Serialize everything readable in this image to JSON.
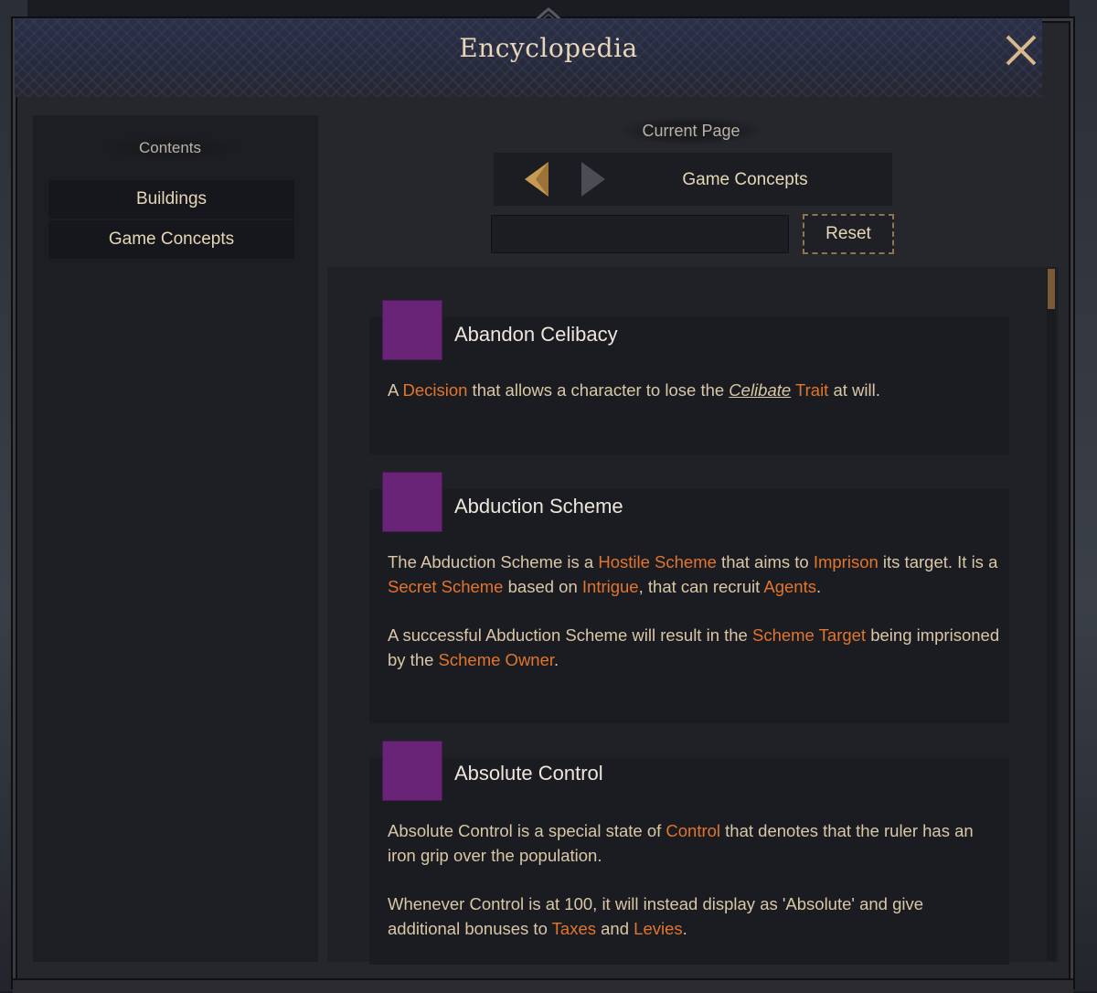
{
  "window": {
    "title": "Encyclopedia",
    "close_icon": "close-icon"
  },
  "sidebar": {
    "header": "Contents",
    "items": [
      {
        "label": "Buildings"
      },
      {
        "label": "Game Concepts"
      }
    ]
  },
  "navigation": {
    "current_page_label": "Current Page",
    "page": "Game Concepts",
    "back_icon": "arrow-left-icon",
    "forward_icon": "arrow-right-icon",
    "search": {
      "value": "",
      "placeholder": ""
    },
    "reset_label": "Reset"
  },
  "entries": [
    {
      "title": "Abandon Celibacy",
      "icon_color": "#6a2477",
      "paragraphs": [
        [
          {
            "text": "A "
          },
          {
            "text": "Decision",
            "link": true
          },
          {
            "text": " that allows a character to lose the "
          },
          {
            "text": "Celibate",
            "link": "italic"
          },
          {
            "text": " "
          },
          {
            "text": "Trait",
            "link": true
          },
          {
            "text": " at will."
          }
        ]
      ]
    },
    {
      "title": "Abduction Scheme",
      "icon_color": "#6a2477",
      "paragraphs": [
        [
          {
            "text": "The Abduction Scheme is a "
          },
          {
            "text": "Hostile Scheme",
            "link": true
          },
          {
            "text": " that aims to "
          },
          {
            "text": "Imprison",
            "link": true
          },
          {
            "text": " its target. It is a "
          },
          {
            "text": "Secret Scheme",
            "link": true
          },
          {
            "text": " based on "
          },
          {
            "text": "Intrigue",
            "link": true
          },
          {
            "text": ", that can recruit "
          },
          {
            "text": "Agents",
            "link": true
          },
          {
            "text": "."
          }
        ],
        [
          {
            "text": "A successful Abduction Scheme will result in the "
          },
          {
            "text": "Scheme Target",
            "link": true
          },
          {
            "text": " being imprisoned by the "
          },
          {
            "text": "Scheme Owner",
            "link": true
          },
          {
            "text": "."
          }
        ]
      ]
    },
    {
      "title": "Absolute Control",
      "icon_color": "#6a2477",
      "paragraphs": [
        [
          {
            "text": "Absolute Control is a special state of "
          },
          {
            "text": "Control",
            "link": true
          },
          {
            "text": " that denotes that the ruler has an iron grip over the population."
          }
        ],
        [
          {
            "text": "Whenever Control is at 100, it will instead display as 'Absolute' and give additional bonuses to "
          },
          {
            "text": "Taxes",
            "link": true
          },
          {
            "text": " and "
          },
          {
            "text": "Levies",
            "link": true
          },
          {
            "text": "."
          }
        ]
      ]
    }
  ],
  "colors": {
    "link": "#e2752d",
    "body_text": "#d9c7a6",
    "title_text": "#e8d6b6",
    "entry_icon": "#6a2477",
    "background": "#26272d"
  }
}
